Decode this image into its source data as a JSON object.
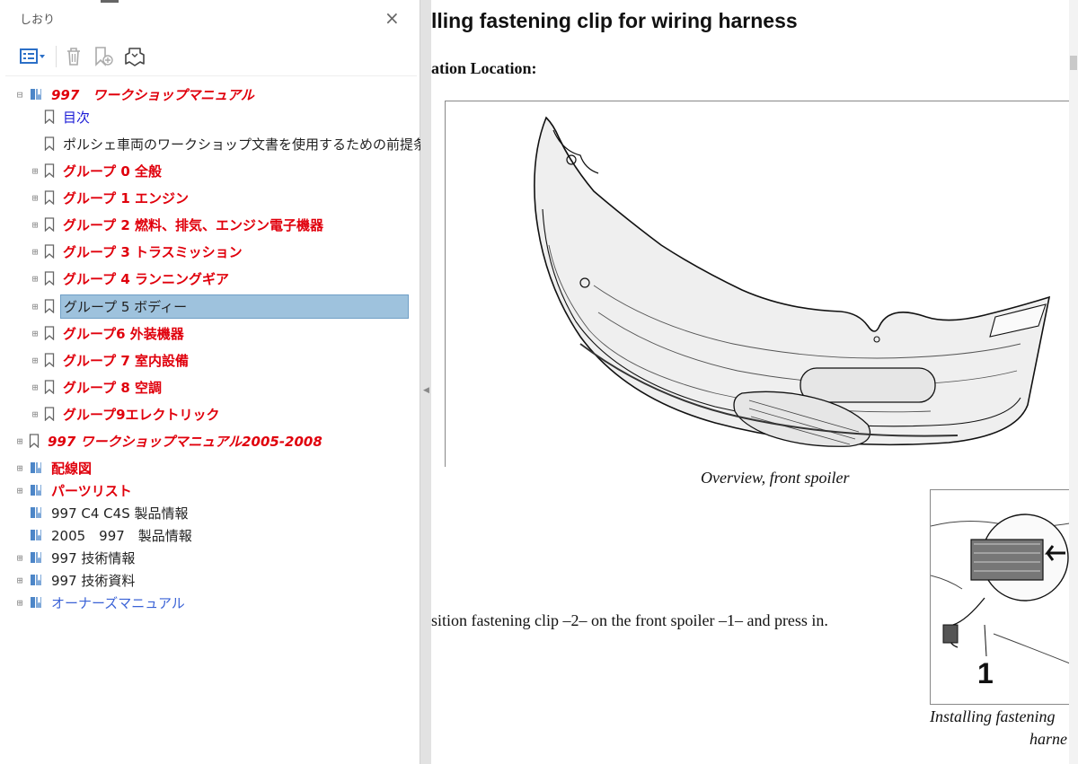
{
  "sidebar": {
    "title": "しおり",
    "close_label": "×",
    "toolbar": {
      "options_icon": "list-options-icon",
      "delete_icon": "trash-icon",
      "new_bookmark_icon": "new-bookmark-icon",
      "find_bookmark_icon": "find-bookmark-icon"
    },
    "tree": [
      {
        "label": "997　ワークショップマニュアル",
        "expander": "⊟",
        "level": 0,
        "style": "red-i",
        "icon": "book"
      },
      {
        "label": "目次",
        "expander": "",
        "level": 1,
        "style": "blue",
        "icon": "bookmark"
      },
      {
        "label": "ポルシェ車両のワークショップ文書を使用するための前提条件",
        "expander": "",
        "level": 1,
        "style": "black",
        "icon": "bookmark"
      },
      {
        "label": "グループ 0 全般",
        "expander": "⊞",
        "level": 1,
        "style": "red",
        "icon": "bookmark"
      },
      {
        "label": "グループ 1 エンジン",
        "expander": "⊞",
        "level": 1,
        "style": "red",
        "icon": "bookmark"
      },
      {
        "label": "グループ 2 燃料、排気、エンジン電子機器",
        "expander": "⊞",
        "level": 1,
        "style": "red",
        "icon": "bookmark"
      },
      {
        "label": "グループ 3 トラスミッション",
        "expander": "⊞",
        "level": 1,
        "style": "red",
        "icon": "bookmark"
      },
      {
        "label": "グループ 4 ランニングギア",
        "expander": "⊞",
        "level": 1,
        "style": "red",
        "icon": "bookmark"
      },
      {
        "label": "グループ 5 ボディー",
        "expander": "⊞",
        "level": 1,
        "style": "selected",
        "icon": "bookmark"
      },
      {
        "label": "グループ6 外装機器",
        "expander": "⊞",
        "level": 1,
        "style": "red",
        "icon": "bookmark"
      },
      {
        "label": "グループ 7 室内設備",
        "expander": "⊞",
        "level": 1,
        "style": "red",
        "icon": "bookmark"
      },
      {
        "label": "グループ 8 空調",
        "expander": "⊞",
        "level": 1,
        "style": "red",
        "icon": "bookmark"
      },
      {
        "label": "グループ9エレクトリック",
        "expander": "⊞",
        "level": 1,
        "style": "red",
        "icon": "bookmark"
      },
      {
        "label": "997 ワークショップマニュアル2005-2008",
        "expander": "⊞",
        "level": 0,
        "style": "red-i",
        "icon": "bookmark"
      },
      {
        "label": "配線図",
        "expander": "⊞",
        "level": 0,
        "style": "red",
        "icon": "book"
      },
      {
        "label": "パーツリスト",
        "expander": "⊞",
        "level": 0,
        "style": "red",
        "icon": "book"
      },
      {
        "label": "997 C4 C4S 製品情報",
        "expander": "",
        "level": 0,
        "style": "black",
        "icon": "book"
      },
      {
        "label": "2005　997　製品情報",
        "expander": "",
        "level": 0,
        "style": "black",
        "icon": "book"
      },
      {
        "label": "997 技術情報",
        "expander": "⊞",
        "level": 0,
        "style": "black",
        "icon": "book"
      },
      {
        "label": "997 技術資料",
        "expander": "⊞",
        "level": 0,
        "style": "black",
        "icon": "book"
      },
      {
        "label": "オーナーズマニュアル",
        "expander": "⊞",
        "level": 0,
        "style": "bluelink",
        "icon": "book"
      }
    ]
  },
  "document": {
    "title": "lling fastening clip for wiring harness",
    "location_heading": "ation Location:",
    "figure1_caption": "Overview, front spoiler",
    "step_text": "sition fastening clip –2– on the front spoiler –1– and press in.",
    "figure2_callout": "1",
    "figure2_caption_line1": "Installing fastening",
    "figure2_caption_line2": "harne"
  },
  "colors": {
    "red": "#e0000c",
    "link_blue": "#1a1ad6",
    "selection": "#9ec2dd"
  }
}
